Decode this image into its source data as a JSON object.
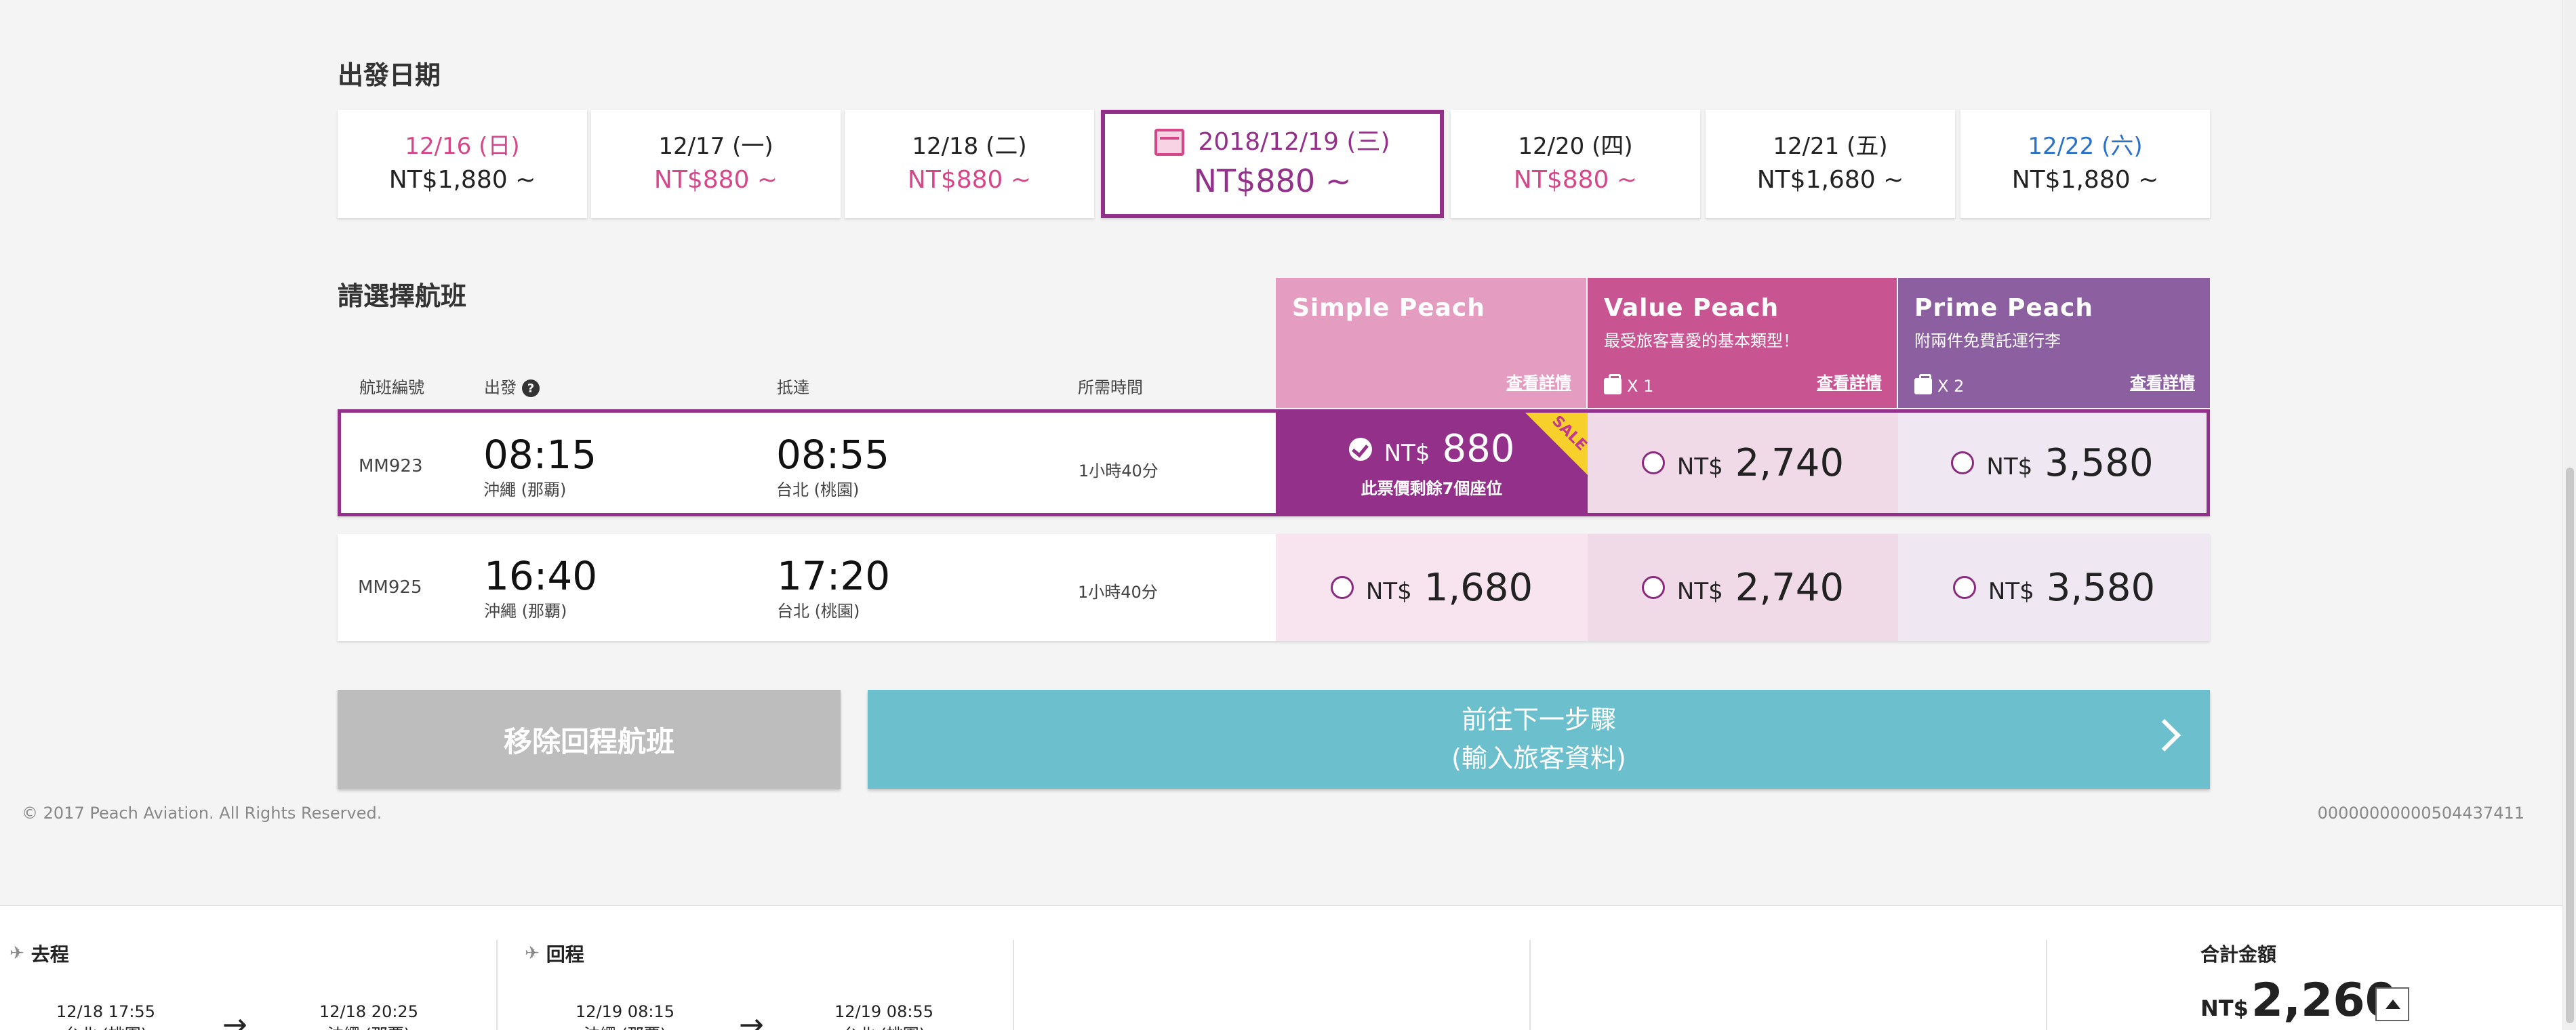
{
  "departure_date": {
    "title": "出發日期",
    "tabs": [
      {
        "date": "12/16 (日)",
        "price": "NT$1,880 ~",
        "date_style": "sun",
        "price_style": ""
      },
      {
        "date": "12/17 (一)",
        "price": "NT$880 ~",
        "date_style": "",
        "price_style": "pink"
      },
      {
        "date": "12/18 (二)",
        "price": "NT$880 ~",
        "date_style": "",
        "price_style": "pink"
      },
      {
        "date": "2018/12/19 (三)",
        "price": "NT$880 ~",
        "date_style": "active",
        "price_style": "active"
      },
      {
        "date": "12/20 (四)",
        "price": "NT$880 ~",
        "date_style": "",
        "price_style": "pink"
      },
      {
        "date": "12/21 (五)",
        "price": "NT$1,680 ~",
        "date_style": "",
        "price_style": ""
      },
      {
        "date": "12/22 (六)",
        "price": "NT$1,880 ~",
        "date_style": "sat",
        "price_style": ""
      }
    ]
  },
  "flight_select": {
    "title": "請選擇航班",
    "columns": {
      "flight_no": "航班編號",
      "depart": "出發",
      "arrive": "抵達",
      "duration": "所需時間"
    },
    "fares": [
      {
        "name": "Simple Peach",
        "sub": "",
        "bags": "",
        "detail": "查看詳情",
        "color": "#e49dc0"
      },
      {
        "name": "Value Peach",
        "sub": "最受旅客喜愛的基本類型！",
        "bags": "X 1",
        "detail": "查看詳情",
        "color": "#c85591"
      },
      {
        "name": "Prime Peach",
        "sub": "附兩件免費託運行李",
        "bags": "X 2",
        "detail": "查看詳情",
        "color": "#8b5fa0"
      }
    ],
    "flights": [
      {
        "no": "MM923",
        "dep_time": "08:15",
        "dep_city": "沖繩 (那覇)",
        "arr_time": "08:55",
        "arr_city": "台北 (桃園)",
        "duration": "1小時40分",
        "prices": [
          "880",
          "2,740",
          "3,580"
        ],
        "selected_fare": 0,
        "seats_left": "此票價剩餘7個座位",
        "sale": "SALE"
      },
      {
        "no": "MM925",
        "dep_time": "16:40",
        "dep_city": "沖繩 (那覇)",
        "arr_time": "17:20",
        "arr_city": "台北 (桃園)",
        "duration": "1小時40分",
        "prices": [
          "1,680",
          "2,740",
          "3,580"
        ],
        "selected_fare": null
      }
    ],
    "currency": "NT$",
    "cell_colors": [
      "#f7e4ee",
      "#f1dae7",
      "#efe8f3"
    ]
  },
  "actions": {
    "remove_return": "移除回程航班",
    "next_line1": "前往下一步驟",
    "next_line2": "(輸入旅客資料)"
  },
  "footer": {
    "copyright": "© 2017 Peach Aviation. All Rights Reserved.",
    "doc_id": "00000000000504437411"
  },
  "summary": {
    "outbound": {
      "label": "去程",
      "from_time": "12/18 17:55",
      "from_city": "台北 (桃園)",
      "to_time": "12/18 20:25",
      "to_city": "沖繩 (那覇)"
    },
    "return": {
      "label": "回程",
      "from_time": "12/19 08:15",
      "from_city": "沖繩 (那覇)",
      "to_time": "12/19 08:55",
      "to_city": "台北 (桃園)"
    },
    "arrow": "→",
    "total_label": "合計金額",
    "total_currency": "NT$",
    "total_value": "2,260"
  }
}
